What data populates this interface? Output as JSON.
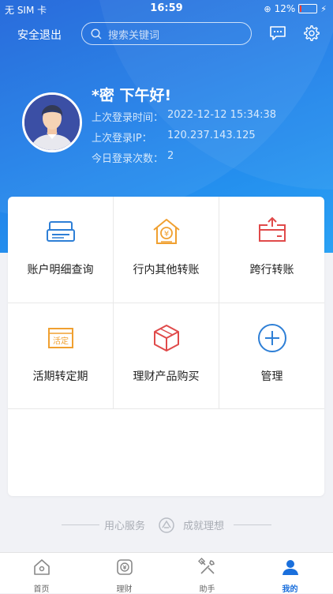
{
  "status_bar": {
    "carrier": "无 SIM 卡",
    "time": "16:59",
    "battery": "12%",
    "battery_level": 0.12
  },
  "header": {
    "logout_label": "安全退出",
    "search_placeholder": "搜索关键词"
  },
  "profile": {
    "greeting": "*密 下午好!",
    "last_login_time_label": "上次登录时间：",
    "last_login_time": "2022-12-12 15:34:38",
    "last_login_ip_label": "上次登录IP：",
    "last_login_ip": "120.237.143.125",
    "today_login_count_label": "今日登录次数：",
    "today_login_count": "2"
  },
  "functions": [
    {
      "label": "账户明细查询",
      "icon": "account-detail-icon"
    },
    {
      "label": "行内其他转账",
      "icon": "transfer-house-icon"
    },
    {
      "label": "跨行转账",
      "icon": "interbank-transfer-icon"
    },
    {
      "label": "活期转定期",
      "icon": "current-to-fixed-icon"
    },
    {
      "label": "理财产品购买",
      "icon": "wealth-product-icon"
    },
    {
      "label": "管理",
      "icon": "add-circle-icon"
    }
  ],
  "slogan": {
    "left": "用心服务",
    "right": "成就理想"
  },
  "tabs": [
    {
      "label": "首页",
      "icon": "home-icon"
    },
    {
      "label": "理财",
      "icon": "wealth-icon"
    },
    {
      "label": "助手",
      "icon": "tools-icon"
    },
    {
      "label": "我的",
      "icon": "user-icon"
    }
  ],
  "colors": {
    "primary": "#1a6fdc",
    "icon_blue": "#2e7fd6",
    "icon_orange": "#f0a030",
    "icon_red": "#e04a4a"
  }
}
